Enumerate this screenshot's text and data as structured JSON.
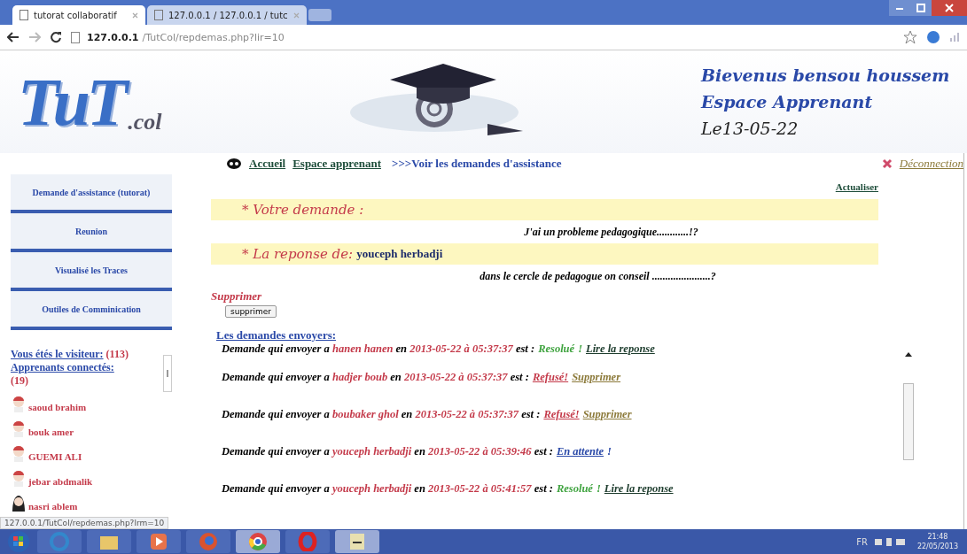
{
  "browser": {
    "tabs": [
      {
        "label": "tutorat collaboratif",
        "selected": true
      },
      {
        "label": "127.0.0.1 / 127.0.0.1 / tutc",
        "selected": false
      }
    ],
    "url_host": "127.0.0.1",
    "url_path": "/TutCol/repdemas.php?lir=10"
  },
  "header": {
    "logo_main": "TuT",
    "logo_sub": ".col",
    "welcome": "Bievenus bensou houssem",
    "space": "Espace Apprenant",
    "date": "Le13-05-22"
  },
  "nav": {
    "home": "Accueil",
    "space": "Espace apprenant",
    "current": ">>>Voir les demandes d'assistance",
    "logout": "Déconnection"
  },
  "sidebar": {
    "menu": [
      "Demande d'assistance (tutorat)",
      "Reunion",
      "Visualisé les Traces",
      "Outiles de Comminication"
    ],
    "visitor_label": "Vous étés le visiteur:",
    "visitor_count": "(113)",
    "connected_label": "Apprenants connectés:",
    "connected_count": "(19)",
    "users": [
      {
        "name": "saoud brahim",
        "kind": "male"
      },
      {
        "name": "bouk amer",
        "kind": "male"
      },
      {
        "name": "GUEMI ALI",
        "kind": "male"
      },
      {
        "name": "jebar abdmalik",
        "kind": "male"
      },
      {
        "name": "nasri ablem",
        "kind": "female"
      }
    ]
  },
  "content": {
    "refresh": "Actualiser",
    "question_label": "* Votre demande :",
    "question": "J'ai un probleme pedagogique............!?",
    "answer_label": "* La reponse de:",
    "answer_author": "youceph herbadji",
    "answer": "dans le cercle de pedagogue on conseil ......................?",
    "delete_label": "Supprimer",
    "delete_button": "supprimer",
    "list_title": "Les demandes envoyers:",
    "requests": [
      {
        "lead": "Demande qui envoyer a",
        "name": "hanen hanen",
        "on": "en",
        "date": "2013-05-22 à 05:37:37",
        "is": "est :",
        "status": "Resolué",
        "kind": "resolved",
        "suffix": "!",
        "action": "Lire la reponse"
      },
      {
        "lead": "Demande qui envoyer a",
        "name": "hadjer boub",
        "on": "en",
        "date": "2013-05-22 à 05:37:37",
        "is": "est :",
        "status": "Refusé!",
        "kind": "refused",
        "action": "Supprimer"
      },
      {
        "lead": "Demande qui envoyer a",
        "name": "boubaker ghol",
        "on": "en",
        "date": "2013-05-22 à 05:37:37",
        "is": "est :",
        "status": "Refusé!",
        "kind": "refused",
        "action": "Supprimer"
      },
      {
        "lead": "Demande qui envoyer a",
        "name": "youceph herbadji",
        "on": "en",
        "date": "2013-05-22 à 05:39:46",
        "is": "est :",
        "status": "En attente",
        "kind": "pending",
        "suffix": "!"
      },
      {
        "lead": "Demande qui envoyer a",
        "name": "youceph herbadji",
        "on": "en",
        "date": "2013-05-22 à 05:41:57",
        "is": "est :",
        "status": "Resolué",
        "kind": "resolved",
        "suffix": "!",
        "action": "Lire la reponse"
      }
    ]
  },
  "status_url": "127.0.0.1/TutCol/repdemas.php?lrm=10",
  "taskbar": {
    "language": "FR",
    "time": "21:48",
    "date": "22/05/2013"
  }
}
